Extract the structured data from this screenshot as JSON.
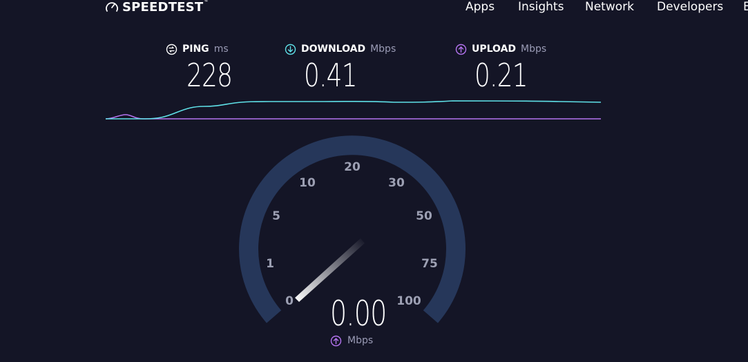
{
  "header": {
    "logo_text": "SPEEDTEST",
    "nav": [
      "Apps",
      "Insights",
      "Network",
      "Developers",
      "E"
    ]
  },
  "metrics": {
    "ping": {
      "label": "PING",
      "unit": "ms",
      "value": "228",
      "icon": "ping-icon",
      "color": "#ffffff"
    },
    "download": {
      "label": "DOWNLOAD",
      "unit": "Mbps",
      "value": "0.41",
      "icon": "download-icon",
      "color": "#5fe1e8"
    },
    "upload": {
      "label": "UPLOAD",
      "unit": "Mbps",
      "value": "0.21",
      "icon": "upload-icon",
      "color": "#b574f0"
    }
  },
  "gauge": {
    "ticks": [
      "0",
      "1",
      "5",
      "10",
      "20",
      "30",
      "50",
      "75",
      "100"
    ],
    "current_value": "0.00",
    "current_unit": "Mbps",
    "unit_icon": "upload-icon"
  },
  "colors": {
    "background": "#141526",
    "download_line": "#5fe1e8",
    "upload_line": "#b574f0",
    "gauge_track": "#26375a"
  }
}
